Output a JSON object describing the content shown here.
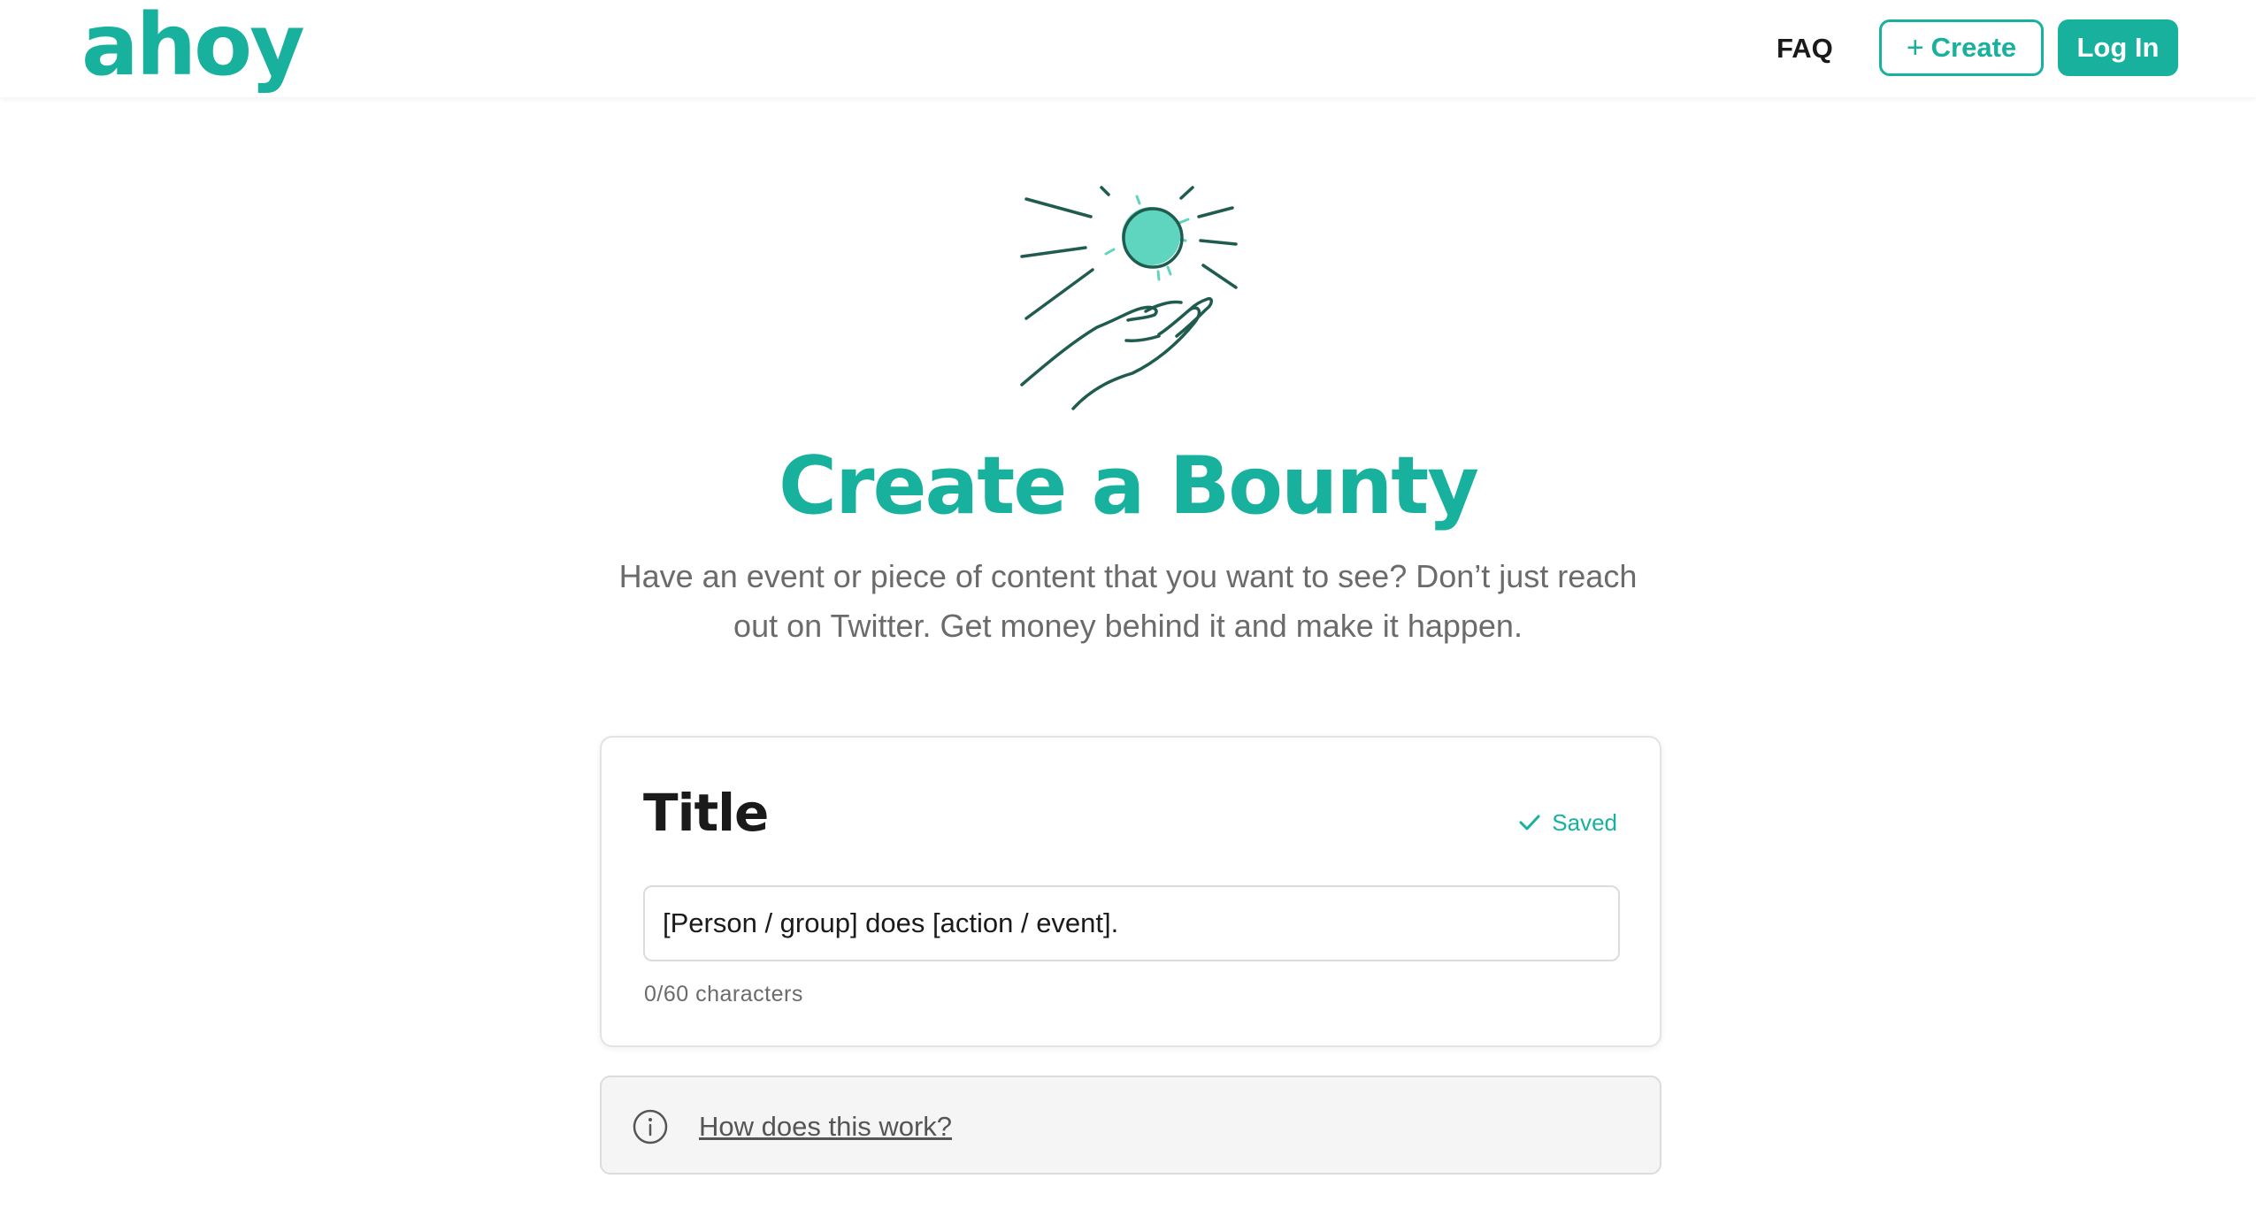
{
  "header": {
    "logo": "ahoy",
    "nav_faq": "FAQ",
    "create_plus": "+",
    "create_label": "Create",
    "login_label": "Log In"
  },
  "hero": {
    "illustration": "hand-holding-glowing-coin-illustration",
    "title": "Create a Bounty",
    "subtitle": "Have an event or piece of content that you want to see? Don’t just reach out on Twitter. Get money behind it and make it happen."
  },
  "title_section": {
    "heading": "Title",
    "saved_label": "Saved",
    "input_value": "",
    "input_placeholder": "[Person / group] does [action / event].",
    "char_count": "0/60 characters"
  },
  "info": {
    "link_label": "How does this work?"
  },
  "colors": {
    "accent": "#17b19d",
    "illustration_line": "#1f5c4f",
    "illustration_fill": "#5fd4be",
    "muted_text": "#6b6b6b",
    "info_bg": "#f5f5f5"
  },
  "icons": {
    "saved": "check-icon",
    "info": "info-circle-icon",
    "create": "plus-icon"
  }
}
